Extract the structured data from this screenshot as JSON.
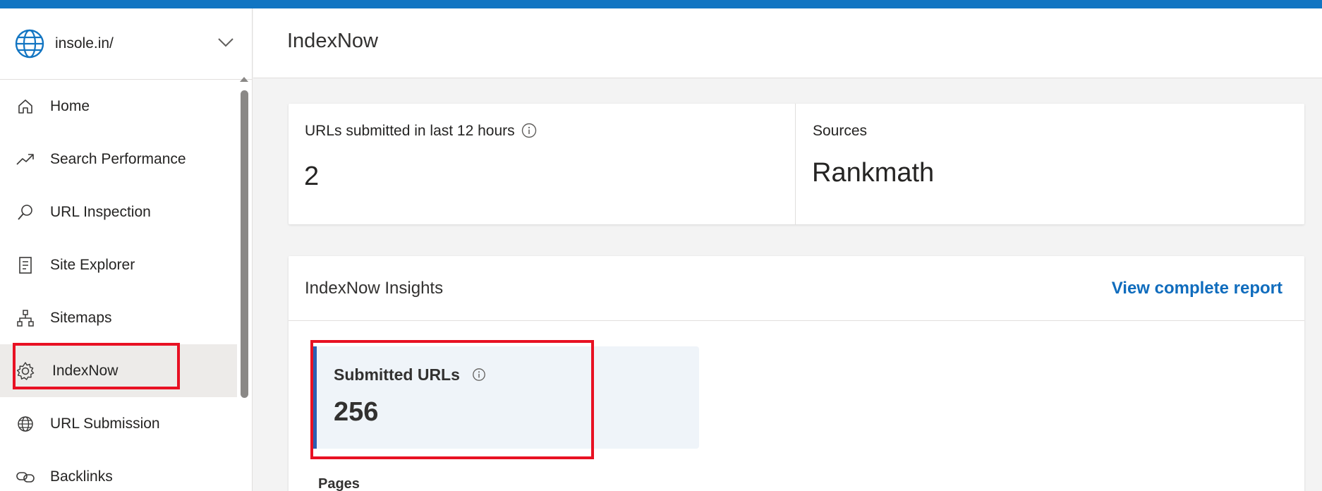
{
  "site": {
    "name": "insole.in/",
    "icon": "globe-icon"
  },
  "nav": {
    "items": [
      {
        "label": "Home",
        "icon": "home-icon"
      },
      {
        "label": "Search Performance",
        "icon": "trend-up-icon"
      },
      {
        "label": "URL Inspection",
        "icon": "search-icon"
      },
      {
        "label": "Site Explorer",
        "icon": "document-list-icon"
      },
      {
        "label": "Sitemaps",
        "icon": "sitemap-icon"
      },
      {
        "label": "IndexNow",
        "icon": "gear-icon",
        "active": true
      },
      {
        "label": "URL Submission",
        "icon": "globe-icon"
      },
      {
        "label": "Backlinks",
        "icon": "link-icon"
      }
    ]
  },
  "header": {
    "title": "IndexNow"
  },
  "stats": {
    "submitted_label": "URLs submitted in last 12 hours",
    "submitted_value": "2",
    "sources_label": "Sources",
    "sources_value": "Rankmath"
  },
  "insights": {
    "title": "IndexNow Insights",
    "view_report": "View complete report",
    "metric_label": "Submitted URLs",
    "metric_value": "256",
    "pages_label": "Pages"
  },
  "colors": {
    "accent": "#1275c2",
    "link": "#0f6cbd",
    "highlight": "#e81123",
    "metric_accent": "#2b5fb3"
  }
}
